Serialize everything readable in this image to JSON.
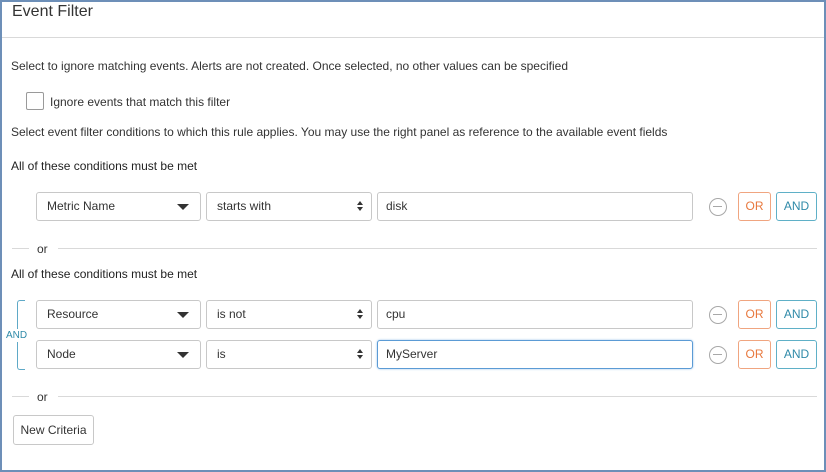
{
  "header": {
    "title": "Event Filter"
  },
  "ignore_section": {
    "description": "Select to ignore matching events. Alerts are not created. Once selected, no other values can be specified",
    "checkbox_label": "Ignore events that match this filter",
    "checked": false
  },
  "conditions_intro": "Select event filter conditions to which this rule applies. You may use the right panel as reference to the available event fields",
  "groups": [
    {
      "heading": "All of these conditions must be met",
      "rows": [
        {
          "field": "Metric Name",
          "operator": "starts with",
          "value": "disk",
          "or_label": "OR",
          "and_label": "AND"
        }
      ]
    },
    {
      "heading": "All of these conditions must be met",
      "connector": "AND",
      "rows": [
        {
          "field": "Resource",
          "operator": "is not",
          "value": "cpu",
          "or_label": "OR",
          "and_label": "AND"
        },
        {
          "field": "Node",
          "operator": "is",
          "value": "MyServer",
          "or_label": "OR",
          "and_label": "AND"
        }
      ]
    }
  ],
  "separators": {
    "or_label": "or"
  },
  "new_criteria_label": "New Criteria",
  "colors": {
    "or_accent": "#e8783d",
    "and_accent": "#2f8aa8",
    "frame_border": "#6d8fb8"
  }
}
